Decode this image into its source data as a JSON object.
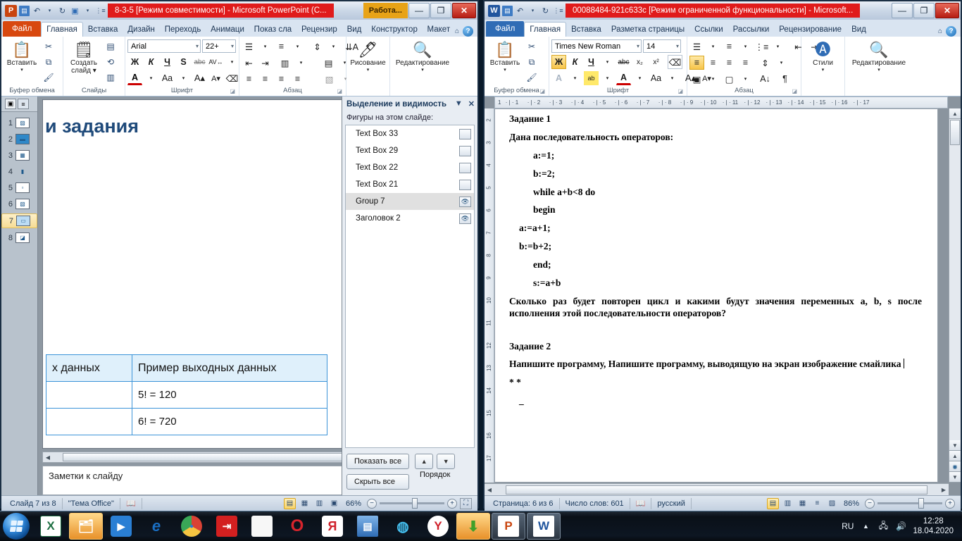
{
  "powerpoint": {
    "title": "8-3-5 [Режим совместимости]  -  Microsoft PowerPoint (C...",
    "contextual_tab": "Работа...",
    "window_buttons": {
      "minimize": "—",
      "maximize": "❐",
      "close": "✕"
    },
    "tabs": [
      {
        "label": "Файл",
        "kind": "file"
      },
      {
        "label": "Главная",
        "kind": "active"
      },
      {
        "label": "Вставка",
        "kind": "normal"
      },
      {
        "label": "Дизайн",
        "kind": "normal"
      },
      {
        "label": "Переходь",
        "kind": "normal"
      },
      {
        "label": "Анимаци",
        "kind": "normal"
      },
      {
        "label": "Показ сла",
        "kind": "normal"
      },
      {
        "label": "Рецензир",
        "kind": "normal"
      },
      {
        "label": "Вид",
        "kind": "normal"
      },
      {
        "label": "Конструктор",
        "kind": "normal"
      },
      {
        "label": "Макет",
        "kind": "normal"
      }
    ],
    "ribbon": {
      "clipboard": {
        "group_label": "Буфер обмена",
        "paste": "Вставить",
        "cut_icon": "scissors-icon",
        "copy_icon": "copy-icon",
        "format_painter_icon": "format-painter-icon"
      },
      "slides": {
        "group_label": "Слайды",
        "new_slide": "Создать\nслайд"
      },
      "font": {
        "group_label": "Шрифт",
        "font_name": "Arial",
        "font_size": "22+",
        "bold": "Ж",
        "italic": "К",
        "underline": "Ч",
        "shadow": "S",
        "strike": "abc",
        "spacing": "AV",
        "font_color": "A",
        "change_case": "Aa",
        "grow": "A",
        "shrink": "A",
        "clear_format": "clear-format-icon"
      },
      "paragraph": {
        "group_label": "Абзац",
        "bullets_icon": "bullet-list-icon",
        "numbering_icon": "numbered-list-icon",
        "line_spacing_icon": "line-spacing-icon",
        "text_direction_icon": "text-direction-icon",
        "decrease_indent_icon": "decrease-indent-icon",
        "increase_indent_icon": "increase-indent-icon",
        "columns_icon": "columns-icon",
        "align_left_icon": "align-left-icon",
        "align_center_icon": "align-center-icon",
        "align_right_icon": "align-right-icon",
        "justify_icon": "justify-icon",
        "smartart_icon": "smartart-icon",
        "align_text_icon": "align-text-icon"
      },
      "drawing": {
        "label": "Рисование"
      },
      "editing": {
        "label": "Редактирование"
      }
    },
    "slide_panel": {
      "outline_tab_icon": "slides-tab-icon",
      "outline_tab2_icon": "outline-tab-icon",
      "slides": [
        {
          "num": "1"
        },
        {
          "num": "2"
        },
        {
          "num": "3"
        },
        {
          "num": "4"
        },
        {
          "num": "5"
        },
        {
          "num": "6"
        },
        {
          "num": "7",
          "selected": true
        },
        {
          "num": "8"
        }
      ]
    },
    "slide": {
      "title": "і и задания",
      "table": {
        "header": [
          "х данных",
          "Пример  выходных данных"
        ],
        "rows": [
          [
            "",
            "5! = 120"
          ],
          [
            "",
            "6! = 720"
          ]
        ]
      },
      "notes_placeholder": "Заметки к слайду"
    },
    "selection_pane": {
      "title": "Выделение и видимость",
      "collapse_icon": "chevron-down-icon",
      "close_icon": "close-icon",
      "subtitle": "Фигуры на этом слайде:",
      "shapes": [
        {
          "name": "Text Box 33",
          "visible": false
        },
        {
          "name": "Text Box 29",
          "visible": false
        },
        {
          "name": "Text Box 22",
          "visible": false
        },
        {
          "name": "Text Box 21",
          "visible": false
        },
        {
          "name": "Group 7",
          "visible": true,
          "selected": true
        },
        {
          "name": "Заголовок 2",
          "visible": true
        }
      ],
      "show_all": "Показать все",
      "hide_all": "Скрыть все",
      "order_label": "Порядок",
      "order_up_icon": "arrow-up-icon",
      "order_down_icon": "arrow-down-icon"
    },
    "status": {
      "slide_counter": "Слайд 7 из 8",
      "theme": "\"Тема Office\"",
      "spellcheck_icon": "spellcheck-error-icon",
      "zoom": "66%",
      "views": [
        "normal-view-icon",
        "slide-sorter-icon",
        "reading-view-icon",
        "slideshow-icon"
      ],
      "zoom_out": "−",
      "zoom_in": "+",
      "fit_icon": "fit-slide-icon"
    }
  },
  "word": {
    "title": "00088484-921c633c [Режим ограниченной функциональности]  -  Microsoft...",
    "window_buttons": {
      "minimize": "—",
      "maximize": "❐",
      "close": "✕"
    },
    "tabs": [
      {
        "label": "Файл",
        "kind": "file"
      },
      {
        "label": "Главная",
        "kind": "active"
      },
      {
        "label": "Вставка",
        "kind": "normal"
      },
      {
        "label": "Разметка страницы",
        "kind": "normal"
      },
      {
        "label": "Ссылки",
        "kind": "normal"
      },
      {
        "label": "Рассылки",
        "kind": "normal"
      },
      {
        "label": "Рецензирование",
        "kind": "normal"
      },
      {
        "label": "Вид",
        "kind": "normal"
      }
    ],
    "ribbon": {
      "clipboard": {
        "group_label": "Буфер обмена",
        "paste": "Вставить"
      },
      "font": {
        "group_label": "Шрифт",
        "font_name": "Times New Roman",
        "font_size": "14",
        "bold": "Ж",
        "italic": "К",
        "underline": "Ч",
        "strike": "abc",
        "subscript": "x₂",
        "superscript": "x²",
        "clear_format_icon": "clear-format-icon",
        "text_effect": "A",
        "highlight": "ab",
        "font_color": "A",
        "change_case": "Aa",
        "grow": "A",
        "shrink": "A"
      },
      "paragraph": {
        "group_label": "Абзац",
        "bullets_icon": "bullet-list-icon",
        "numbering_icon": "numbered-list-icon",
        "multilevel_icon": "multilevel-list-icon",
        "decrease_indent_icon": "decrease-indent-icon",
        "increase_indent_icon": "increase-indent-icon",
        "align_left_icon": "align-left-icon",
        "align_center_icon": "align-center-icon",
        "align_right_icon": "align-right-icon",
        "justify_icon": "justify-icon",
        "line_spacing_icon": "line-spacing-icon",
        "shading_icon": "shading-icon",
        "borders_icon": "borders-icon",
        "sort_icon": "sort-icon",
        "show_marks_icon": "pilcrow-icon"
      },
      "styles": {
        "label": "Стили"
      },
      "editing": {
        "label": "Редактирование"
      }
    },
    "ruler": {
      "horizontal_ticks": [
        "1",
        "2",
        "3",
        "4",
        "5",
        "6",
        "7",
        "8",
        "9",
        "10",
        "11",
        "12",
        "13",
        "14",
        "15",
        "16",
        "17"
      ],
      "vertical_ticks": [
        "2",
        "3",
        "4",
        "5",
        "6",
        "7",
        "8",
        "9",
        "10",
        "11",
        "12",
        "13",
        "14",
        "15",
        "16",
        "17"
      ]
    },
    "document": {
      "paragraphs": [
        {
          "text": "Задание 1",
          "indent": 0
        },
        {
          "text": "Дана последовательность операторов:",
          "indent": 0
        },
        {
          "text": "a:=1;",
          "indent": 1
        },
        {
          "text": "b:=2;",
          "indent": 1
        },
        {
          "text": "while a+b<8 do",
          "indent": 1,
          "spell": true
        },
        {
          "text": "begin",
          "indent": 1,
          "spell": true
        },
        {
          "text": "a:=a+1;",
          "indent": 2
        },
        {
          "text": "b:=b+2;",
          "indent": 2
        },
        {
          "text": "end;",
          "indent": 1,
          "spell": true
        },
        {
          "text": "s:=a+b",
          "indent": 1
        },
        {
          "text": "Сколько раз будет повторен цикл и какими будут  значения переменных a, b, s после исполнения этой последовательности операторов?",
          "indent": 0
        },
        {
          "text": "",
          "indent": 0
        },
        {
          "text": "Задание 2",
          "indent": 0
        },
        {
          "text": "Напишите программу, Напишите программу, выводящую на экран изображение  смайлика",
          "indent": 0,
          "caret": true
        },
        {
          "text": "*    *",
          "indent": 0
        },
        {
          "text": "_",
          "indent": 1
        }
      ]
    },
    "status": {
      "page": "Страница: 6 из 6",
      "words": "Число слов: 601",
      "spellcheck_icon": "spellcheck-error-icon",
      "language": "русский",
      "zoom": "86%",
      "views": [
        "print-layout-icon",
        "fullscreen-reading-icon",
        "web-layout-icon",
        "outline-icon",
        "draft-icon"
      ],
      "zoom_out": "−",
      "zoom_in": "+"
    }
  },
  "taskbar": {
    "start_icon": "windows-start-icon",
    "items": [
      {
        "icon": "excel-icon",
        "glyph": "X",
        "color": "#1d6f42",
        "state": "normal"
      },
      {
        "icon": "explorer-folder-icon",
        "glyph": "🗂",
        "color": "#e8a317",
        "state": "active"
      },
      {
        "icon": "media-player-icon",
        "glyph": "▶",
        "color": "#2a7fd4",
        "state": "normal"
      },
      {
        "icon": "internet-explorer-icon",
        "glyph": "e",
        "color": "#1a6fc4",
        "state": "normal"
      },
      {
        "icon": "chrome-icon",
        "glyph": "◉",
        "color": "#d94235",
        "state": "normal"
      },
      {
        "icon": "red-arrow-app-icon",
        "glyph": "⇥",
        "color": "#d32020",
        "state": "normal"
      },
      {
        "icon": "document-icon",
        "glyph": "▯",
        "color": "#f5f5f5",
        "state": "normal"
      },
      {
        "icon": "opera-icon",
        "glyph": "O",
        "color": "#d6242c",
        "state": "normal"
      },
      {
        "icon": "yandex-icon",
        "glyph": "Я",
        "color": "#d0202a",
        "state": "normal"
      },
      {
        "icon": "floppy-save-icon",
        "glyph": "💾",
        "color": "#2f6cb5",
        "state": "normal"
      },
      {
        "icon": "download-manager-icon",
        "glyph": "⇩",
        "color": "#1f8fbf",
        "state": "normal"
      },
      {
        "icon": "yandex-browser-icon",
        "glyph": "Y",
        "color": "#d0202a",
        "state": "normal"
      },
      {
        "icon": "download-arrow-icon",
        "glyph": "⬇",
        "color": "#3fa02a",
        "state": "active"
      },
      {
        "icon": "powerpoint-icon",
        "glyph": "P",
        "color": "#c9450f",
        "state": "open"
      },
      {
        "icon": "word-icon",
        "glyph": "W",
        "color": "#20559e",
        "state": "open"
      }
    ],
    "tray": {
      "language": "RU",
      "show_hidden_icon": "chevron-up-icon",
      "network_icon": "network-icon",
      "volume_icon": "volume-icon",
      "time": "12:28",
      "date": "18.04.2020"
    }
  }
}
